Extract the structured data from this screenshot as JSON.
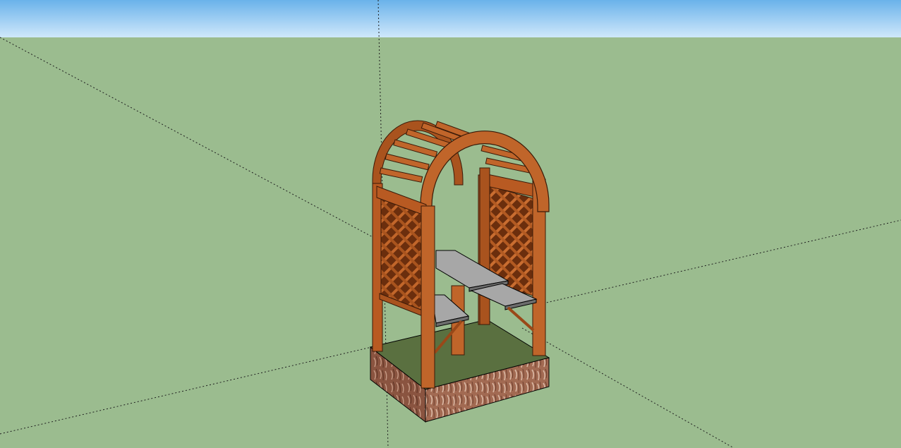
{
  "scene": {
    "sky_color": "#8ec4f0",
    "sky_color_top": "#6ab2ea",
    "sky_color_bottom": "#cfe8fb",
    "ground_color": "#9bbc8f",
    "axis_color": "#1f1f1f"
  },
  "model": {
    "wood_color": "#b85a22",
    "wood_dark": "#7a3812",
    "wood_light": "#d47a3c",
    "lattice_back": "#6b2e0d",
    "seat_color": "#8f8f8f",
    "seat_top": "#a7a7a7",
    "grass_color": "#5a7040",
    "brick_color": "#a26a52"
  }
}
